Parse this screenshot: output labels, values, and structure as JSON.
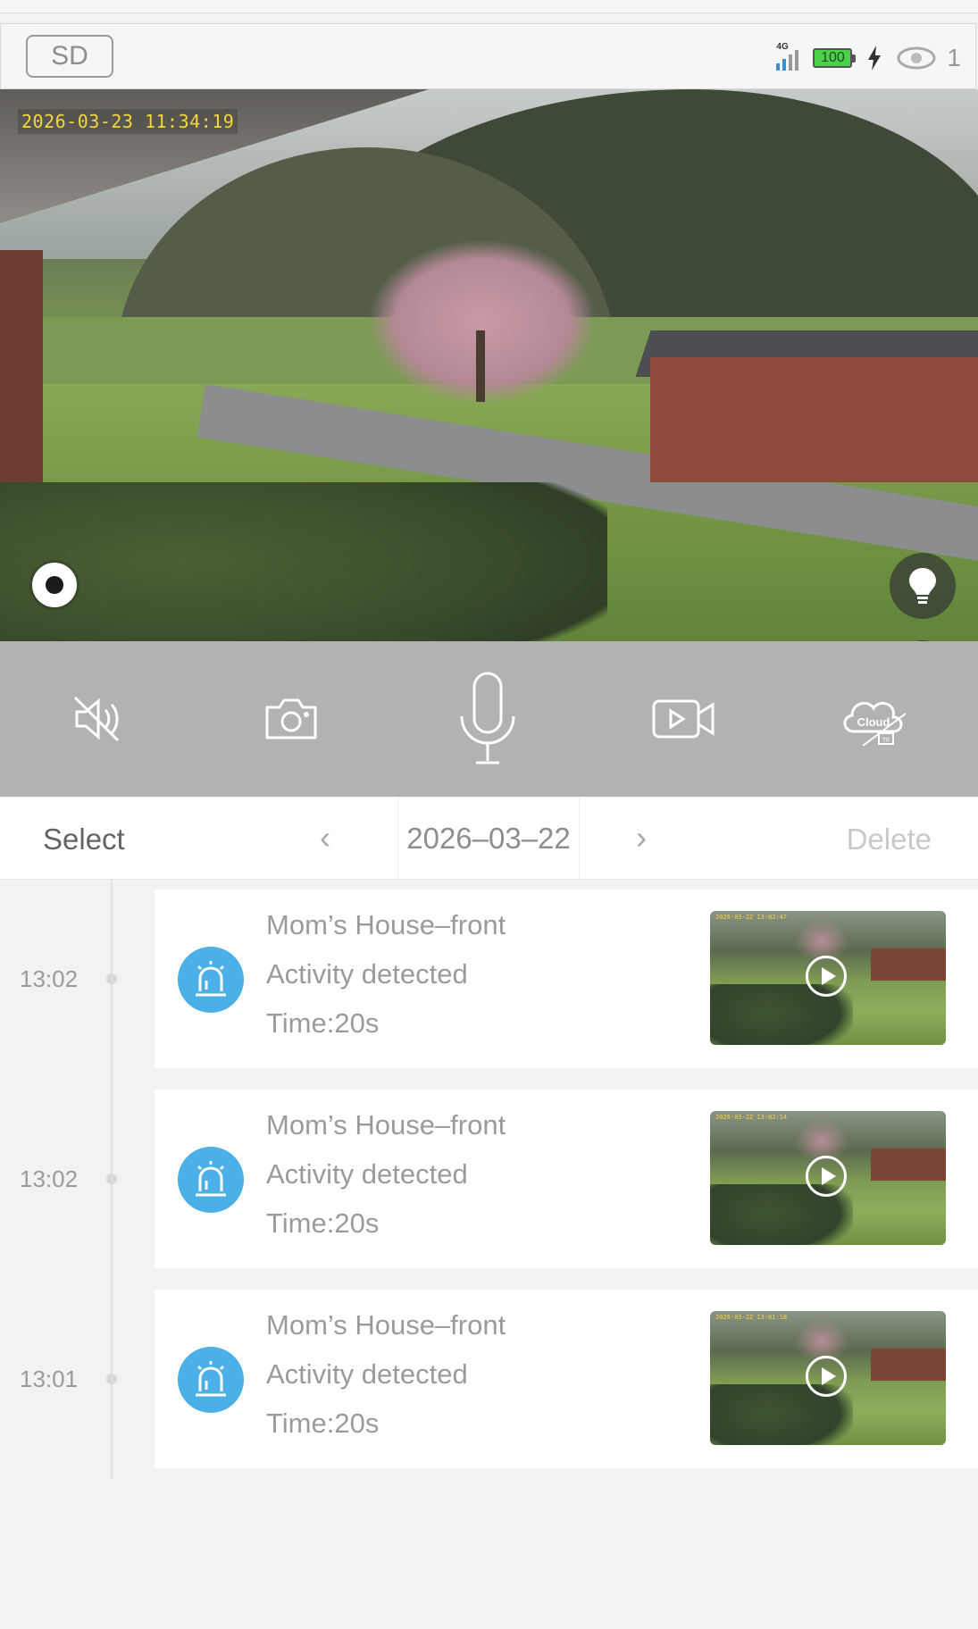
{
  "status_bar": {
    "sd_label": "SD",
    "network": "4G",
    "battery_level": "100",
    "viewer_count": "1",
    "icons": [
      "signal-icon",
      "battery-icon",
      "charging-icon",
      "eye-icon"
    ]
  },
  "camera": {
    "timestamp": "2026-03-23 11:34:19",
    "icons": [
      "ptz-control-icon",
      "light-bulb-icon",
      "fullscreen-icon"
    ]
  },
  "controls": {
    "icons": [
      "speaker-muted-icon",
      "camera-snapshot-icon",
      "microphone-icon",
      "video-record-icon",
      "cloud-tf-icon"
    ],
    "cloud_label": "Cloud",
    "tf_label": "TF"
  },
  "date_bar": {
    "select_label": "Select",
    "prev_label": "‹",
    "date": "2026–03–22",
    "next_label": "›",
    "delete_label": "Delete"
  },
  "events": [
    {
      "time": "13:02",
      "device": "Mom’s House–front",
      "type": "Activity detected",
      "duration": "Time:20s",
      "thumb_stamp": "2026-03-22 13:02:47"
    },
    {
      "time": "13:02",
      "device": "Mom’s House–front",
      "type": "Activity detected",
      "duration": "Time:20s",
      "thumb_stamp": "2026-03-22 13:02:14"
    },
    {
      "time": "13:01",
      "device": "Mom’s House–front",
      "type": "Activity detected",
      "duration": "Time:20s",
      "thumb_stamp": "2026-03-22 13:01:18"
    }
  ],
  "colors": {
    "accent_blue": "#4ab0e6",
    "control_bar": "#b2b2b2",
    "timestamp_yellow": "#f5d63d",
    "battery_green": "#4cd14b"
  }
}
